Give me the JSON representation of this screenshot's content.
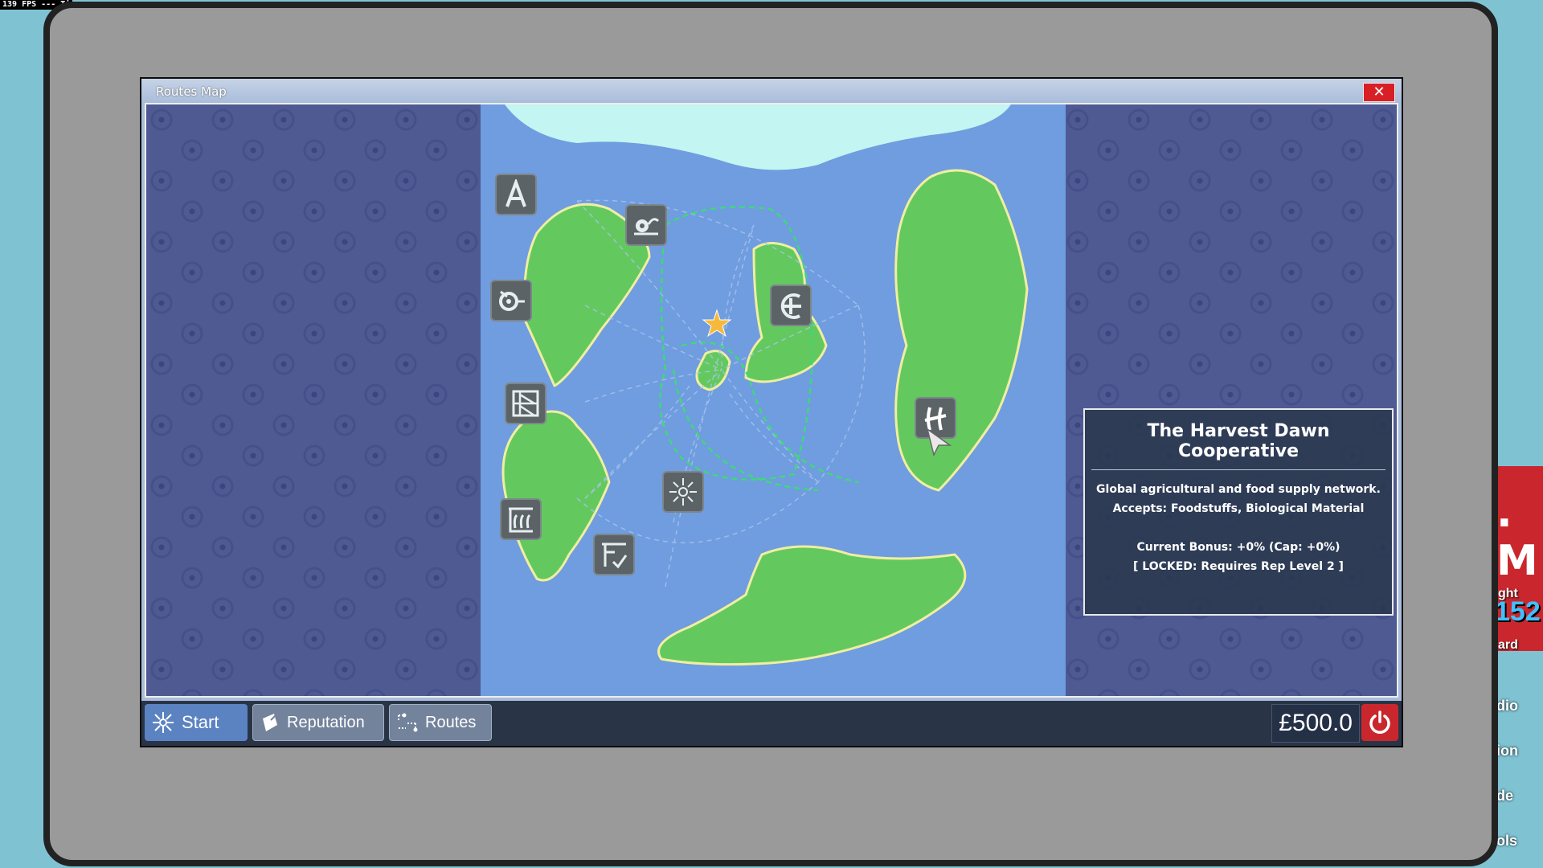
{
  "fps_text": "139 FPS --- Ti",
  "background": {
    "sign_text": ". M",
    "sign_small_top": "ght",
    "sign_number": "152",
    "sign_small_bottom": "ard",
    "side_labels": [
      "dio",
      "ion",
      "de",
      "ols"
    ]
  },
  "window": {
    "title": "Routes Map",
    "close_label": "✕"
  },
  "map": {
    "nodes": [
      {
        "name": "node-a",
        "icon": "letter-a-icon"
      },
      {
        "name": "node-film",
        "icon": "film-camera-icon"
      },
      {
        "name": "node-gear",
        "icon": "gear-wrench-icon"
      },
      {
        "name": "node-crosshair",
        "icon": "circle-cross-icon"
      },
      {
        "name": "node-bars",
        "icon": "hatched-panel-icon"
      },
      {
        "name": "node-harvest",
        "icon": "harvest-symbol-icon"
      },
      {
        "name": "node-sun",
        "icon": "sun-burst-icon"
      },
      {
        "name": "node-grass",
        "icon": "grass-crate-icon"
      },
      {
        "name": "node-check",
        "icon": "frame-check-icon"
      }
    ],
    "player_marker": "star-icon",
    "colors": {
      "sea": "#6f9ddf",
      "land": "#63c95f",
      "ice": "#c3f5f2",
      "route": "#3fd87a"
    }
  },
  "tooltip": {
    "title": "The Harvest Dawn Cooperative",
    "description": "Global agricultural and food supply network.",
    "accepts": "Accepts: Foodstuffs, Biological Material",
    "bonus": "Current Bonus: +0% (Cap: +0%)",
    "locked": "[ LOCKED: Requires Rep Level 2 ]"
  },
  "taskbar": {
    "start_label": "Start",
    "reputation_label": "Reputation",
    "routes_label": "Routes",
    "money": "£500.0"
  }
}
